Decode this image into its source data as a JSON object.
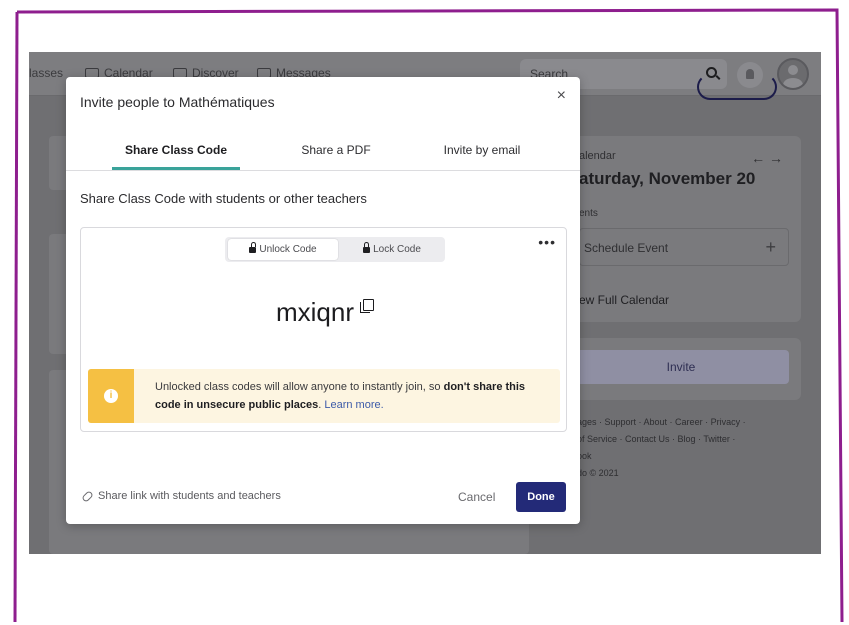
{
  "nav": {
    "classes": "lasses",
    "calendar": "Calendar",
    "discover": "Discover",
    "messages": "Messages",
    "search_placeholder": "Search"
  },
  "right": {
    "calendar_label": "alendar",
    "arrows": "← →",
    "date": "aturday, November 20",
    "events_label": "ents",
    "schedule": "Schedule Event",
    "schedule_plus": "+",
    "view_calendar": "ew Full Calendar",
    "invite": "Invite",
    "footer_line1": "ages · Support · About · Career · Privacy ·",
    "footer_line2": "of Service · Contact Us · Blog · Twitter ·",
    "footer_line3": "ook",
    "footer_line4": "do © 2021"
  },
  "modal": {
    "title": "Invite people to Mathématiques",
    "close": "×",
    "tabs": [
      "Share Class Code",
      "Share a PDF",
      "Invite by email"
    ],
    "subtitle": "Share Class Code with students or other teachers",
    "unlock": "Unlock Code",
    "lock": "Lock Code",
    "more": "•••",
    "code": "mxiqnr",
    "info_glyph": "i",
    "alert_pre": "Unlocked class codes will allow anyone to instantly join, so ",
    "alert_bold": "don't share this code in unsecure public places",
    "alert_post": ". ",
    "alert_link": "Learn more.",
    "share_link": "Share link with students and teachers",
    "cancel": "Cancel",
    "done": "Done"
  },
  "colors": {
    "frame_border": "#8e1e8e",
    "accent_teal": "#3aa39a",
    "done_button": "#232a78",
    "alert_yellow": "#f5c043"
  }
}
